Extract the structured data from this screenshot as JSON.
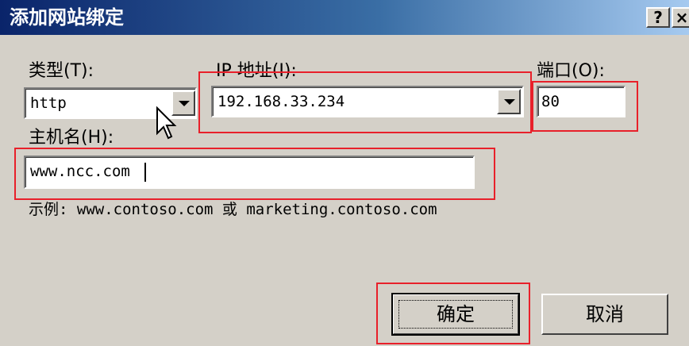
{
  "dialog": {
    "title": "添加网站绑定",
    "help_button": "?",
    "close_button": "×"
  },
  "type_field": {
    "label": "类型(T):",
    "value": "http"
  },
  "ip_field": {
    "label": "IP 地址(I):",
    "value": "192.168.33.234"
  },
  "port_field": {
    "label": "端口(O):",
    "value": "80"
  },
  "host_field": {
    "label": "主机名(H):",
    "value": "www.ncc.com"
  },
  "example_text": "示例: www.contoso.com 或 marketing.contoso.com",
  "buttons": {
    "ok": "确定",
    "cancel": "取消"
  },
  "colors": {
    "title_start": "#0a246a",
    "title_end": "#a6caf0",
    "face": "#d4d0c8",
    "highlight_box": "#e8202a"
  }
}
